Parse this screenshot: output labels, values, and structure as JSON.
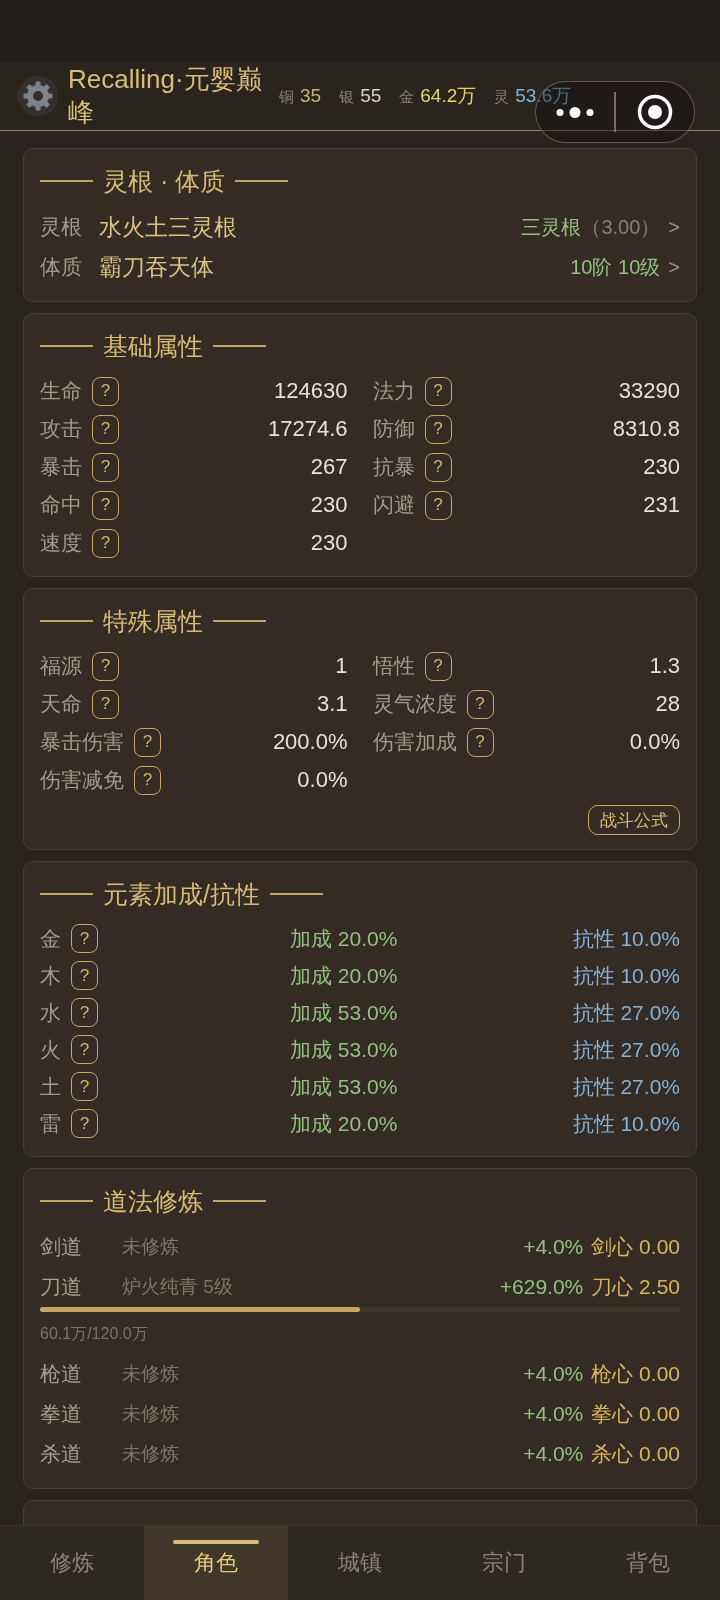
{
  "header": {
    "title": "Recalling·元婴巅峰",
    "currencies": [
      {
        "label": "铜",
        "value": "35",
        "color": "#c9b07a"
      },
      {
        "label": "银",
        "value": "55",
        "color": "#d8d3cb"
      },
      {
        "label": "金",
        "value": "64.2万",
        "color": "#ecd062"
      },
      {
        "label": "灵",
        "value": "53.6万",
        "color": "#80b4d9"
      }
    ]
  },
  "root_constitution": {
    "title": "灵根 · 体质",
    "rows": [
      {
        "label": "灵根",
        "value": "水火土三灵根",
        "grade": "三灵根",
        "score": "（3.00）",
        "arrow": ">"
      },
      {
        "label": "体质",
        "value": "霸刀吞天体",
        "grade": "10阶 10级",
        "arrow": ">"
      }
    ]
  },
  "basic_attributes": {
    "title": "基础属性",
    "items": [
      {
        "label": "生命",
        "hint": "?",
        "value": "124630"
      },
      {
        "label": "法力",
        "hint": "?",
        "value": "33290"
      },
      {
        "label": "攻击",
        "hint": "?",
        "value": "17274.6"
      },
      {
        "label": "防御",
        "hint": "?",
        "value": "8310.8"
      },
      {
        "label": "暴击",
        "hint": "?",
        "value": "267"
      },
      {
        "label": "抗暴",
        "hint": "?",
        "value": "230"
      },
      {
        "label": "命中",
        "hint": "?",
        "value": "230"
      },
      {
        "label": "闪避",
        "hint": "?",
        "value": "231"
      },
      {
        "label": "速度",
        "hint": "?",
        "value": "230"
      }
    ]
  },
  "special_attributes": {
    "title": "特殊属性",
    "items": [
      {
        "label": "福源",
        "hint": "?",
        "value": "1"
      },
      {
        "label": "悟性",
        "hint": "?",
        "value": "1.3"
      },
      {
        "label": "天命",
        "hint": "?",
        "value": "3.1"
      },
      {
        "label": "灵气浓度",
        "hint": "?",
        "value": "28"
      },
      {
        "label": "暴击伤害",
        "hint": "?",
        "value": "200.0%"
      },
      {
        "label": "伤害加成",
        "hint": "?",
        "value": "0.0%"
      },
      {
        "label": "伤害减免",
        "hint": "?",
        "value": "0.0%"
      }
    ],
    "button": "战斗公式"
  },
  "elements": {
    "title": "元素加成/抗性",
    "rows": [
      {
        "element": "金",
        "hint": "?",
        "bonus": "加成 20.0%",
        "resistance": "抗性 10.0%"
      },
      {
        "element": "木",
        "hint": "?",
        "bonus": "加成 20.0%",
        "resistance": "抗性 10.0%"
      },
      {
        "element": "水",
        "hint": "?",
        "bonus": "加成 53.0%",
        "resistance": "抗性 27.0%"
      },
      {
        "element": "火",
        "hint": "?",
        "bonus": "加成 53.0%",
        "resistance": "抗性 27.0%"
      },
      {
        "element": "土",
        "hint": "?",
        "bonus": "加成 53.0%",
        "resistance": "抗性 27.0%"
      },
      {
        "element": "雷",
        "hint": "?",
        "bonus": "加成 20.0%",
        "resistance": "抗性 10.0%"
      }
    ]
  },
  "dao_cultivation": {
    "title": "道法修炼",
    "rows": [
      {
        "name": "剑道",
        "status": "未修炼",
        "bonus": "+4.0%",
        "heart": "剑心 0.00"
      },
      {
        "name": "刀道",
        "status": "炉火纯青 5级",
        "bonus": "+629.0%",
        "heart": "刀心 2.50",
        "progress": {
          "level": 0.5,
          "text": "60.1万/120.0万"
        }
      },
      {
        "name": "枪道",
        "status": "未修炼",
        "bonus": "+4.0%",
        "heart": "枪心 0.00"
      },
      {
        "name": "拳道",
        "status": "未修炼",
        "bonus": "+4.0%",
        "heart": "拳心 0.00"
      },
      {
        "name": "杀道",
        "status": "未修炼",
        "bonus": "+4.0%",
        "heart": "杀心 0.00"
      }
    ]
  },
  "tabs": [
    {
      "label": "修炼",
      "selected": false
    },
    {
      "label": "角色",
      "selected": true
    },
    {
      "label": "城镇",
      "selected": false
    },
    {
      "label": "宗门",
      "selected": false
    },
    {
      "label": "背包",
      "selected": false
    }
  ]
}
